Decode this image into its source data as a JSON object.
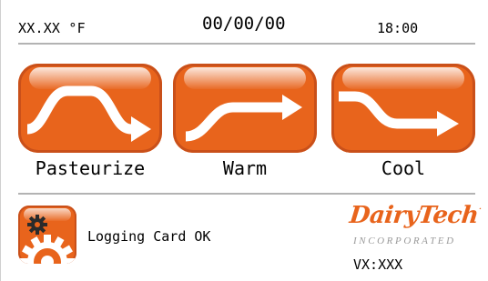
{
  "topbar": {
    "temperature": "XX.XX °F",
    "date": "00/00/00",
    "time": "18:00"
  },
  "modes": [
    {
      "label": "Pasteurize",
      "icon": "pasteurize-icon"
    },
    {
      "label": "Warm",
      "icon": "warm-icon"
    },
    {
      "label": "Cool",
      "icon": "cool-icon"
    }
  ],
  "footer": {
    "status": "Logging Card OK",
    "settings_icon": "gear-icon",
    "logo_main": "Dairy",
    "logo_accent": "Tech",
    "logo_sub": "INCORPORATED",
    "version": "VX:XXX"
  },
  "colors": {
    "accent": "#e8641c",
    "accent_dark": "#c9501a",
    "separator": "#b3b3b3",
    "logo_sub": "#9a9a9a"
  }
}
